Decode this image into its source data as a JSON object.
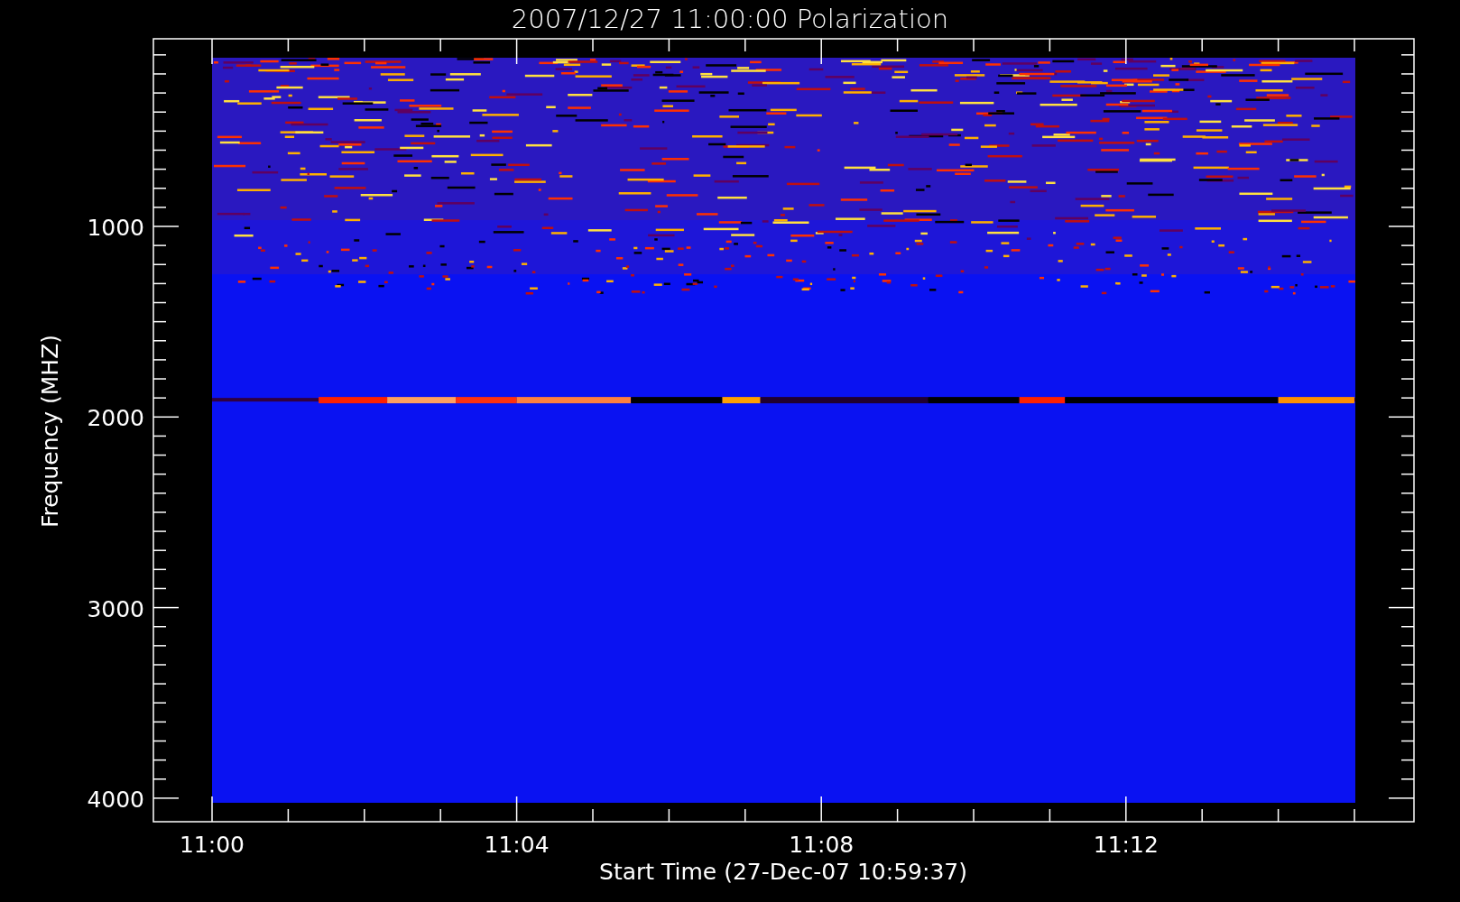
{
  "title": "2007/12/27 11:00:00 Polarization",
  "y_axis": {
    "label": "Frequency (MHZ)",
    "ticks": [
      "1000",
      "2000",
      "3000",
      "4000"
    ]
  },
  "x_axis": {
    "label": "Start Time (27-Dec-07 10:59:37)",
    "ticks": [
      "11:00",
      "11:04",
      "11:08",
      "11:12"
    ]
  }
}
